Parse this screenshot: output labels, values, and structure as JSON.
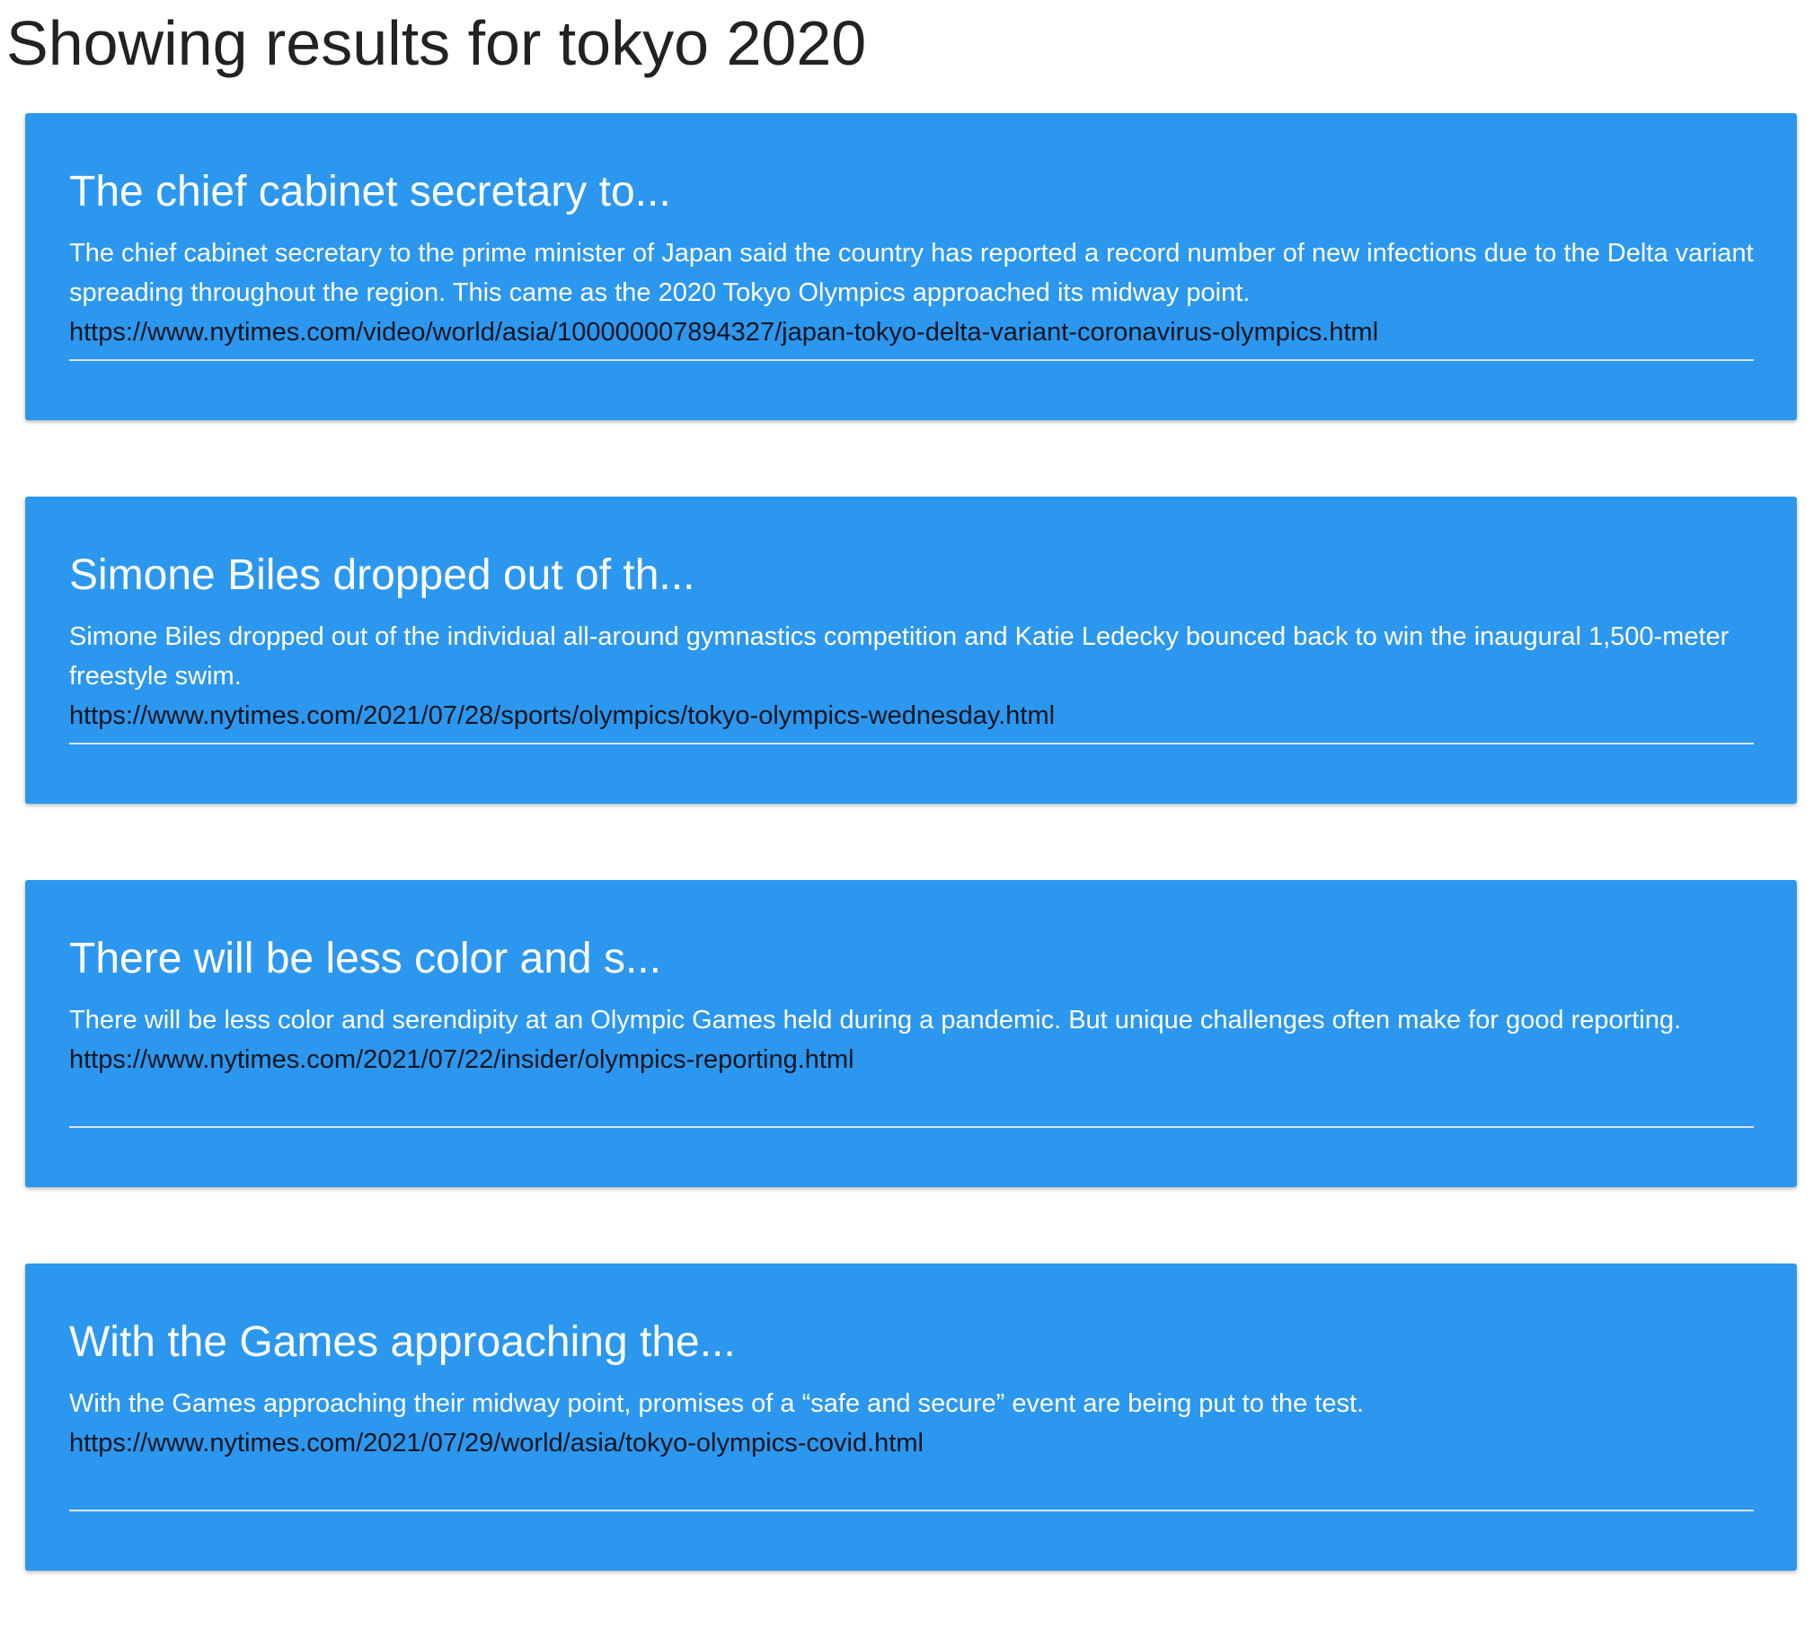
{
  "header": {
    "title": "Showing results for tokyo 2020"
  },
  "results": [
    {
      "title": "The chief cabinet secretary to...",
      "description": "The chief cabinet secretary to the prime minister of Japan said the country has reported a record number of new infections due to the Delta variant spreading throughout the region. This came as the 2020 Tokyo Olympics approached its midway point.",
      "url": "https://www.nytimes.com/video/world/asia/100000007894327/japan-tokyo-delta-variant-coronavirus-olympics.html"
    },
    {
      "title": "Simone Biles dropped out of th...",
      "description": "Simone Biles dropped out of the individual all-around gymnastics competition and Katie Ledecky bounced back to win the inaugural 1,500-meter freestyle swim.",
      "url": "https://www.nytimes.com/2021/07/28/sports/olympics/tokyo-olympics-wednesday.html"
    },
    {
      "title": "There will be less color and s...",
      "description": "There will be less color and serendipity at an Olympic Games held during a pandemic. But unique challenges often make for good reporting.",
      "url": "https://www.nytimes.com/2021/07/22/insider/olympics-reporting.html"
    },
    {
      "title": "With the Games approaching the...",
      "description": "With the Games approaching their midway point, promises of a “safe and secure” event are being put to the test.",
      "url": "https://www.nytimes.com/2021/07/29/world/asia/tokyo-olympics-covid.html"
    }
  ],
  "colors": {
    "card_background": "#2c97ee",
    "card_text": "#ffffff",
    "link_text": "#0d1520",
    "divider": "#d8e6f3"
  }
}
